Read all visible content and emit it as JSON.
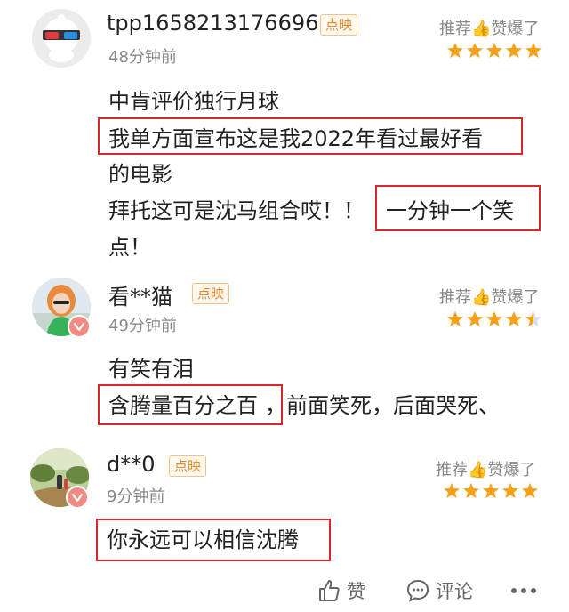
{
  "comments": [
    {
      "username": "tpp1658213176696",
      "tag": "点映",
      "time": "48分钟前",
      "rating_text": "推荐👍赞爆了",
      "rating": 5,
      "avatar_icon": "3d-glasses-mascot-avatar",
      "lines": [
        "中肯评价独行月球",
        "我单方面宣布这是我2022年看过最好看",
        "的电影",
        "拜托这可是沈马组合哎！！",
        "一分钟一个笑",
        "点！"
      ]
    },
    {
      "username": "看**猫",
      "tag": "点映",
      "time": "49分钟前",
      "rating_text": "推荐👍赞爆了",
      "rating": 4.5,
      "avatar_icon": "girl-photo-avatar",
      "lines": [
        "有笑有泪",
        "含腾量百分之百",
        "，前面笑死，后面哭死、"
      ]
    },
    {
      "username": "d**0",
      "tag": "点映",
      "time": "9分钟前",
      "rating_text": "推荐👍赞爆了",
      "rating": 5,
      "avatar_icon": "outdoor-photo-avatar",
      "lines": [
        "你永远可以相信沈腾"
      ]
    }
  ],
  "footer": {
    "like_label": "赞",
    "comment_label": "评论",
    "more_icon": "more-dots-icon"
  },
  "colors": {
    "star": "#f4a21d",
    "highlight_border": "#d8292a",
    "tag_text": "#e08a2e",
    "badge": "#f08a82"
  }
}
